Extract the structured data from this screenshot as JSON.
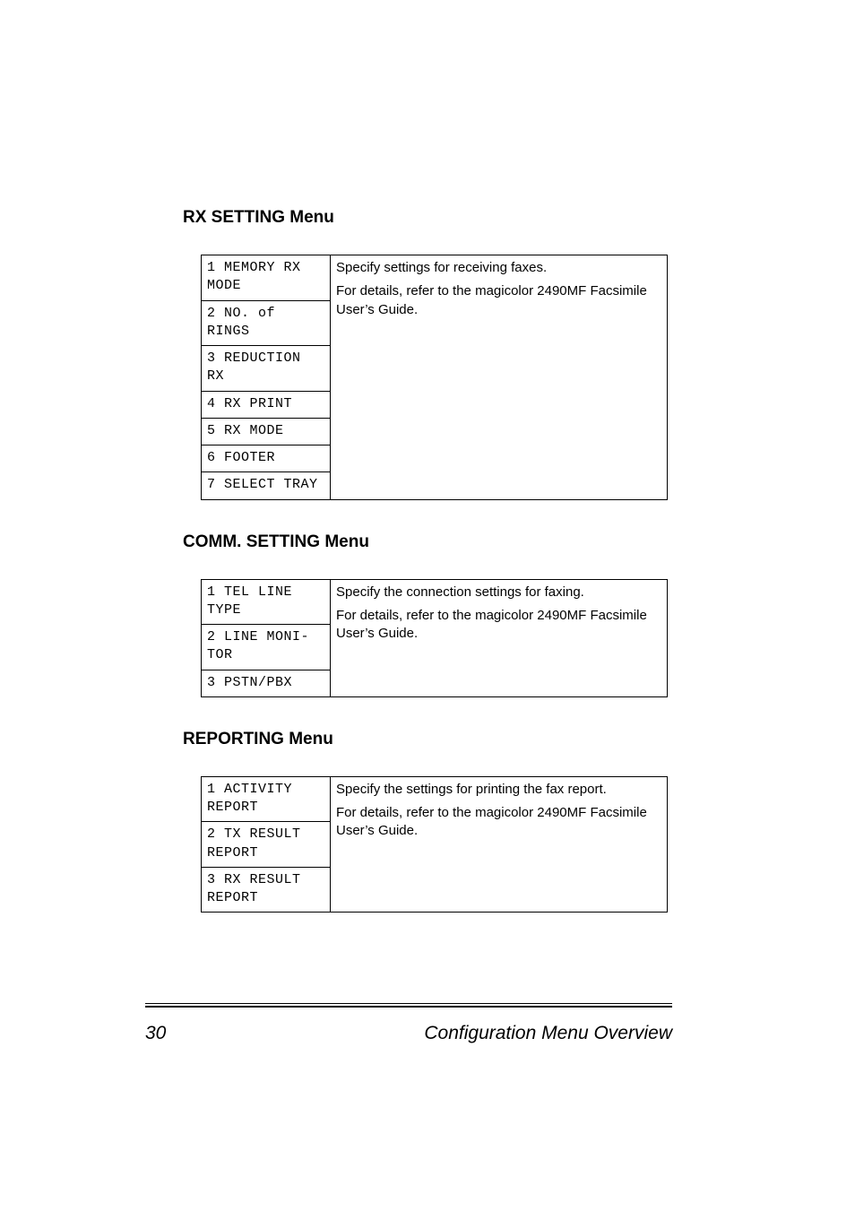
{
  "sections": [
    {
      "heading": "RX SETTING Menu",
      "rows": [
        "1 MEMORY RX MODE",
        "2 NO. of RINGS",
        "3 REDUCTION RX",
        "4 RX PRINT",
        "5 RX MODE",
        "6 FOOTER",
        "7 SELECT TRAY"
      ],
      "desc1": "Specify settings for receiving faxes.",
      "desc2": "For details, refer to the magicolor 2490MF Facsimile User’s Guide."
    },
    {
      "heading": "COMM. SETTING Menu",
      "rows": [
        "1 TEL LINE TYPE",
        "2 LINE MONI-TOR",
        "3 PSTN/PBX"
      ],
      "desc1": "Specify the connection settings for faxing.",
      "desc2": "For details, refer to the magicolor 2490MF Facsimile User’s Guide."
    },
    {
      "heading": "REPORTING Menu",
      "rows": [
        "1 ACTIVITY REPORT",
        "2 TX RESULT REPORT",
        "3 RX RESULT REPORT"
      ],
      "desc1": "Specify the settings for printing the fax report.",
      "desc2": "For details, refer to the magicolor 2490MF Facsimile User’s Guide."
    }
  ],
  "footer": {
    "page_number": "30",
    "title": "Configuration Menu Overview"
  }
}
